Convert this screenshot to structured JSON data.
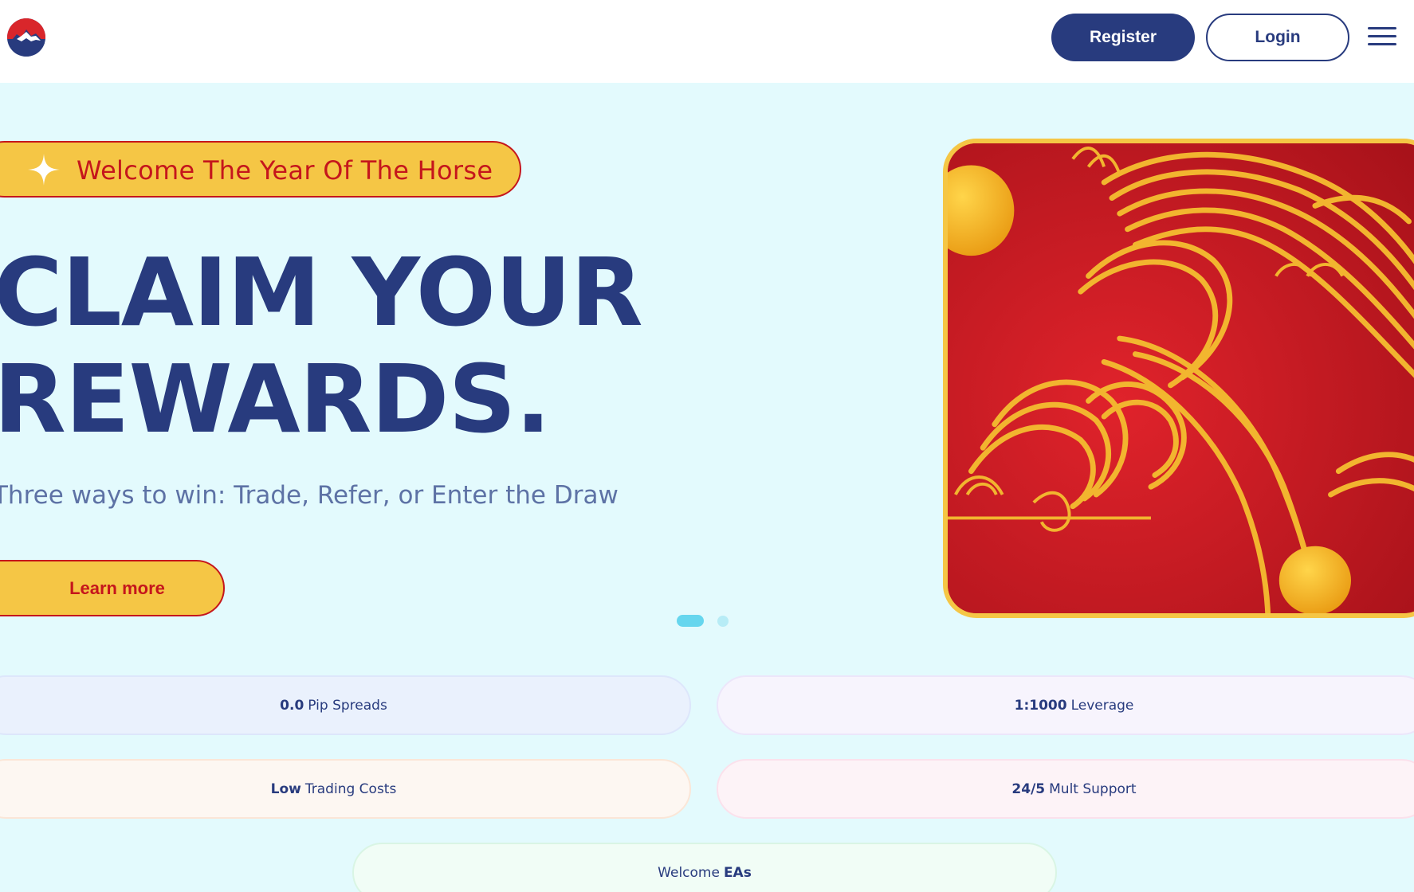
{
  "header": {
    "logo_icon": "mountain-logo-icon",
    "register_label": "Register",
    "login_label": "Login",
    "menu_icon": "hamburger-menu-icon"
  },
  "hero": {
    "badge_icon": "sparkle-star-icon",
    "badge_text": "Welcome The Year Of The Horse",
    "headline_line1": "CLAIM YOUR",
    "headline_line2": "REWARDS.",
    "subline": "Three ways to win: Trade, Refer, or Enter the Draw",
    "cta_label": "Learn more",
    "carousel": {
      "slides": 2,
      "active_slide": 1
    }
  },
  "features": [
    {
      "bold": "0.0",
      "text": "Pip Spreads"
    },
    {
      "bold": "1:1000",
      "text": "Leverage"
    },
    {
      "bold": "Low",
      "text": "Trading Costs"
    },
    {
      "bold": "24/5",
      "text": "Mult Support"
    },
    {
      "text": "Welcome",
      "bold": "EAs"
    }
  ],
  "colors": {
    "brand_navy": "#283b7e",
    "accent_yellow": "#f5c645",
    "accent_red": "#c5161c",
    "hero_background": "#e3fafd"
  }
}
